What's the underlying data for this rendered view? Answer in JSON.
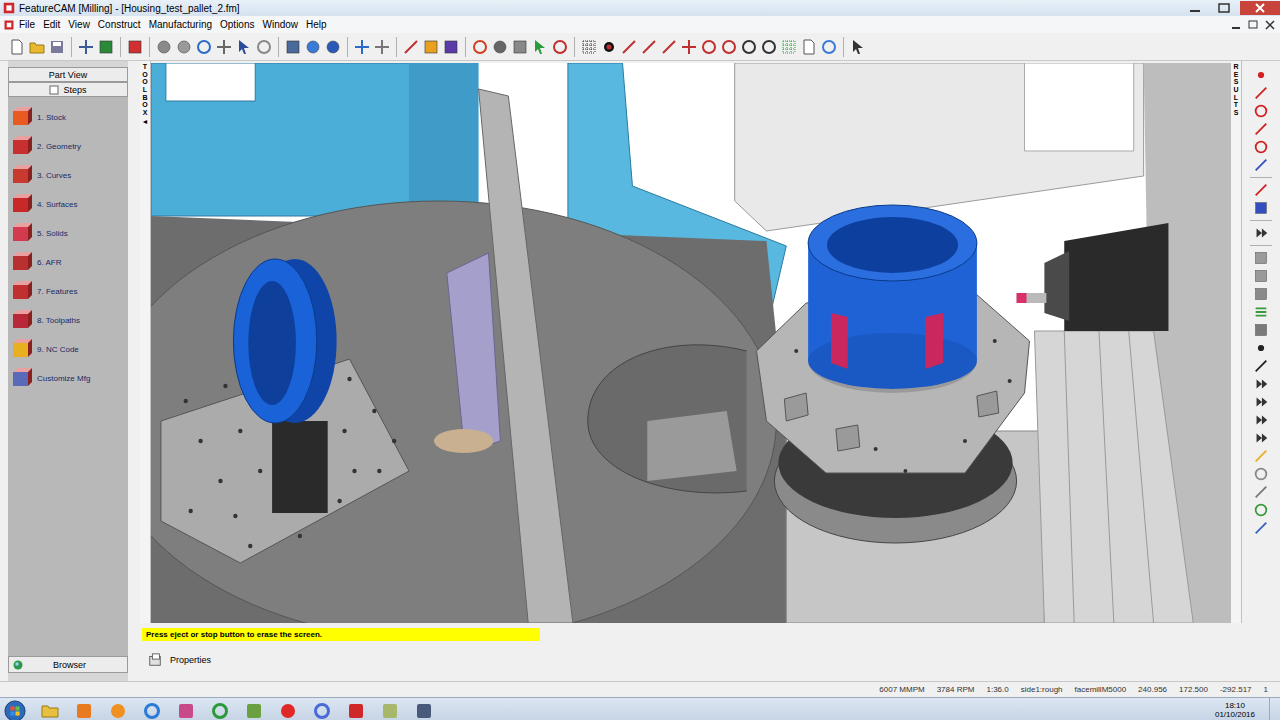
{
  "window": {
    "title": "FeatureCAM [Milling] - [Housing_test_pallet_2.fm]"
  },
  "menu": [
    "File",
    "Edit",
    "View",
    "Construct",
    "Manufacturing",
    "Options",
    "Window",
    "Help"
  ],
  "sidebar": {
    "headers": [
      "Part View",
      "Steps"
    ],
    "steps": [
      "1. Stock",
      "2. Geometry",
      "3. Curves",
      "4. Surfaces",
      "5. Solids",
      "6. AFR",
      "7. Features",
      "8. Toolpaths",
      "9. NC Code",
      "Customize Mfg"
    ],
    "footer": "Browser"
  },
  "toolbox": {
    "label": "TOOLBOX",
    "arrow": "◄"
  },
  "results": {
    "label": "RESULTS"
  },
  "message": "Press eject or stop button to erase the screen.",
  "properties": {
    "label": "Properties"
  },
  "status_bar": [
    "6007 MMPM",
    "3784 RPM",
    "1:36.0",
    "side1:rough",
    "facemillM5000",
    "240.956",
    "172.500",
    "-292.517",
    "1"
  ],
  "taskbar": {
    "time": "18:10",
    "date": "01/10/2016"
  }
}
